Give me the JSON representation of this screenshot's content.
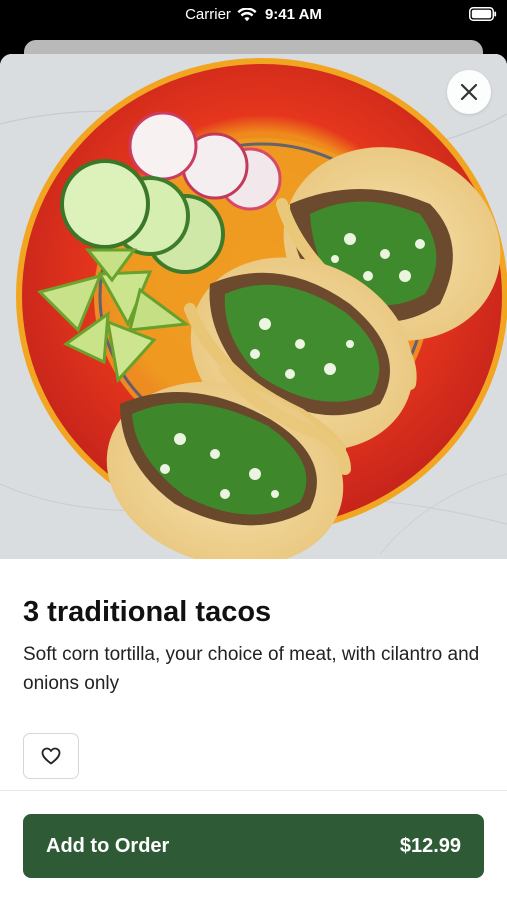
{
  "status_bar": {
    "carrier": "Carrier",
    "time": "9:41 AM",
    "wifi_icon": "wifi-icon",
    "battery_icon": "battery-icon"
  },
  "item": {
    "image_alt_icon": "tacos-photo",
    "title": "3 traditional tacos",
    "description": "Soft corn tortilla, your choice of meat, with cilantro and onions only"
  },
  "actions": {
    "close_icon": "close-icon",
    "favorite_icon": "heart-icon",
    "add_label": "Add to Order",
    "price": "$12.99"
  },
  "colors": {
    "primary_button": "#2e5b35",
    "plate_red": "#e23a1f",
    "plate_orange": "#f19a1e"
  }
}
